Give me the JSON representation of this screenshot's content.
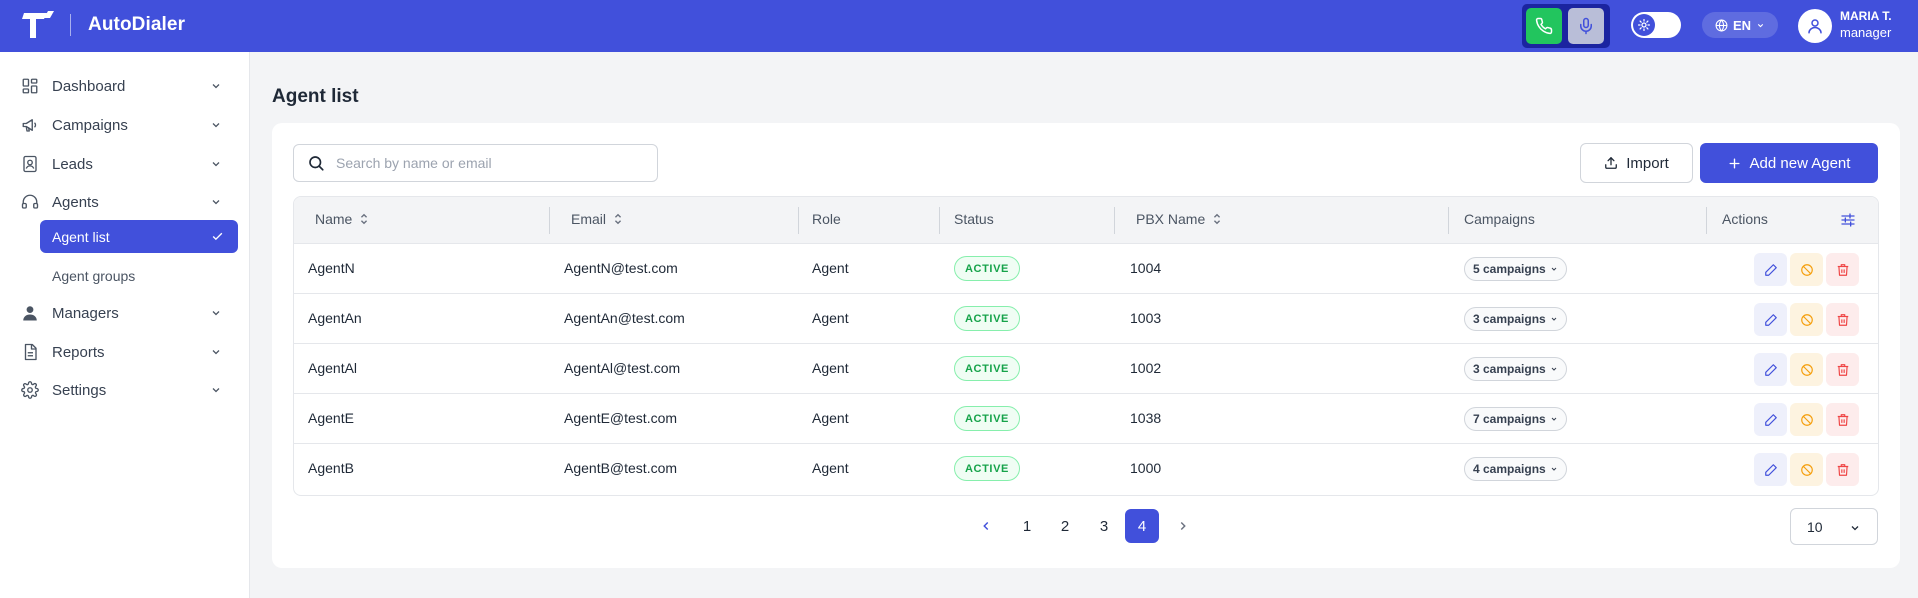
{
  "app": {
    "brand": "AutoDialer"
  },
  "header": {
    "language": "EN",
    "user_name": "MARIA T.",
    "user_role": "manager",
    "accent": "#4150db"
  },
  "sidebar": {
    "items": [
      {
        "label": "Dashboard",
        "icon": "dashboard-icon"
      },
      {
        "label": "Campaigns",
        "icon": "megaphone-icon"
      },
      {
        "label": "Leads",
        "icon": "contact-book-icon"
      },
      {
        "label": "Agents",
        "icon": "headset-icon"
      },
      {
        "label": "Managers",
        "icon": "user-icon"
      },
      {
        "label": "Reports",
        "icon": "document-icon"
      },
      {
        "label": "Settings",
        "icon": "gear-icon"
      }
    ],
    "sub_items": [
      {
        "label": "Agent list",
        "active": true
      },
      {
        "label": "Agent groups",
        "active": false
      }
    ]
  },
  "main": {
    "title": "Agent list",
    "search_placeholder": "Search by name or email",
    "import_label": "Import",
    "add_label": "Add new Agent",
    "columns": [
      "Name",
      "Email",
      "Role",
      "Status",
      "PBX Name",
      "Campaigns",
      "Actions"
    ],
    "rows": [
      {
        "name": "AgentN",
        "email": "AgentN@test.com",
        "role": "Agent",
        "status": "ACTIVE",
        "pbx": "1004",
        "campaigns": "5 campaigns"
      },
      {
        "name": "AgentAn",
        "email": "AgentAn@test.com",
        "role": "Agent",
        "status": "ACTIVE",
        "pbx": "1003",
        "campaigns": "3 campaigns"
      },
      {
        "name": "AgentAl",
        "email": "AgentAl@test.com",
        "role": "Agent",
        "status": "ACTIVE",
        "pbx": "1002",
        "campaigns": "3 campaigns"
      },
      {
        "name": "AgentE",
        "email": "AgentE@test.com",
        "role": "Agent",
        "status": "ACTIVE",
        "pbx": "1038",
        "campaigns": "7 campaigns"
      },
      {
        "name": "AgentB",
        "email": "AgentB@test.com",
        "role": "Agent",
        "status": "ACTIVE",
        "pbx": "1000",
        "campaigns": "4 campaigns"
      }
    ],
    "pagination": {
      "pages": [
        "1",
        "2",
        "3",
        "4"
      ],
      "current": "4",
      "per_page": "10"
    }
  }
}
